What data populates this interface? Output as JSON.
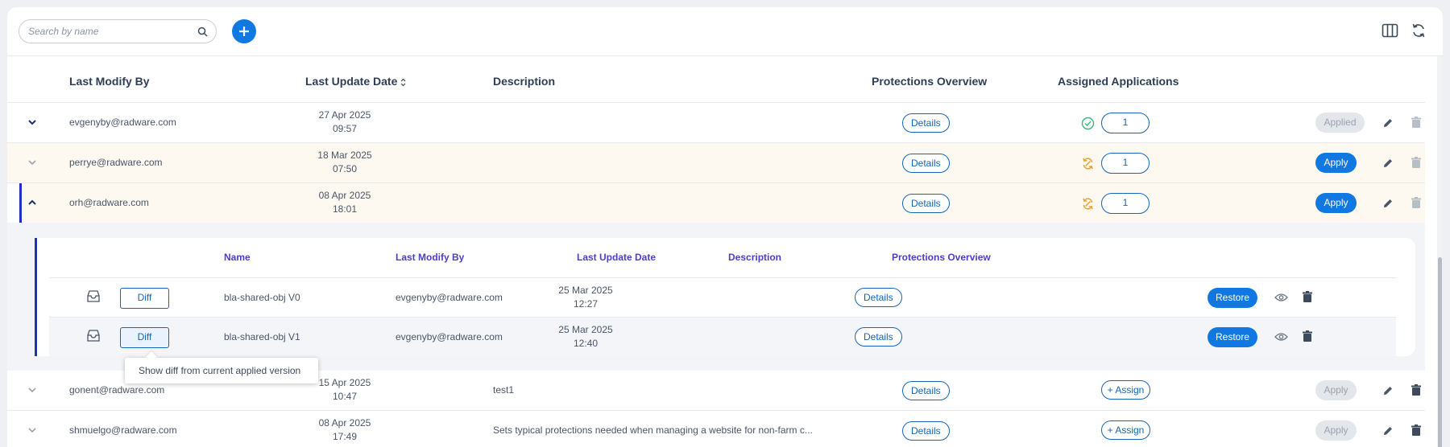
{
  "search": {
    "placeholder": "Search by name"
  },
  "columns": {
    "last_modify_by": "Last Modify By",
    "last_update_date": "Last Update Date",
    "description": "Description",
    "protections_overview": "Protections Overview",
    "assigned_applications": "Assigned Applications"
  },
  "rows": [
    {
      "modified_by": "evgenyby@radware.com",
      "date": "27 Apr 2025",
      "time": "09:57",
      "description": "",
      "details_label": "Details",
      "status_icon": "check-circle-icon",
      "assigned_count": "1",
      "apply_label": "Applied",
      "apply_state": "disabled"
    },
    {
      "modified_by": "perrye@radware.com",
      "date": "18 Mar 2025",
      "time": "07:50",
      "description": "",
      "details_label": "Details",
      "status_icon": "sync-warning-icon",
      "assigned_count": "1",
      "apply_label": "Apply",
      "apply_state": "enabled"
    },
    {
      "modified_by": "orh@radware.com",
      "date": "08 Apr 2025",
      "time": "18:01",
      "description": "",
      "details_label": "Details",
      "status_icon": "sync-warning-icon",
      "assigned_count": "1",
      "apply_label": "Apply",
      "apply_state": "enabled"
    },
    {
      "modified_by": "gonent@radware.com",
      "date": "15 Apr 2025",
      "time": "10:47",
      "description": "test1",
      "details_label": "Details",
      "assign_label": "+ Assign",
      "apply_label": "Apply",
      "apply_state": "disabled"
    },
    {
      "modified_by": "shmuelgo@radware.com",
      "date": "08 Apr 2025",
      "time": "17:49",
      "description": "Sets typical protections needed when managing a website for non-farm c...",
      "details_label": "Details",
      "assign_label": "+ Assign",
      "apply_label": "Apply",
      "apply_state": "disabled"
    }
  ],
  "versions": {
    "columns": {
      "name": "Name",
      "last_modify_by": "Last Modify By",
      "last_update_date": "Last Update Date",
      "description": "Description",
      "protections_overview": "Protections Overview"
    },
    "rows": [
      {
        "diff_label": "Diff",
        "name": "bla-shared-obj V0",
        "modified_by": "evgenyby@radware.com",
        "date": "25 Mar 2025",
        "time": "12:27",
        "details_label": "Details",
        "restore_label": "Restore"
      },
      {
        "diff_label": "Diff",
        "name": "bla-shared-obj V1",
        "modified_by": "evgenyby@radware.com",
        "date": "25 Mar 2025",
        "time": "12:40",
        "details_label": "Details",
        "restore_label": "Restore"
      }
    ]
  },
  "tooltip": {
    "text": "Show diff from current applied version"
  },
  "colors": {
    "primary": "#1078e0",
    "accent_border": "#1f2fc0",
    "success": "#3cb878",
    "warning": "#f0a030",
    "highlight_row": "#fdf9f1"
  }
}
